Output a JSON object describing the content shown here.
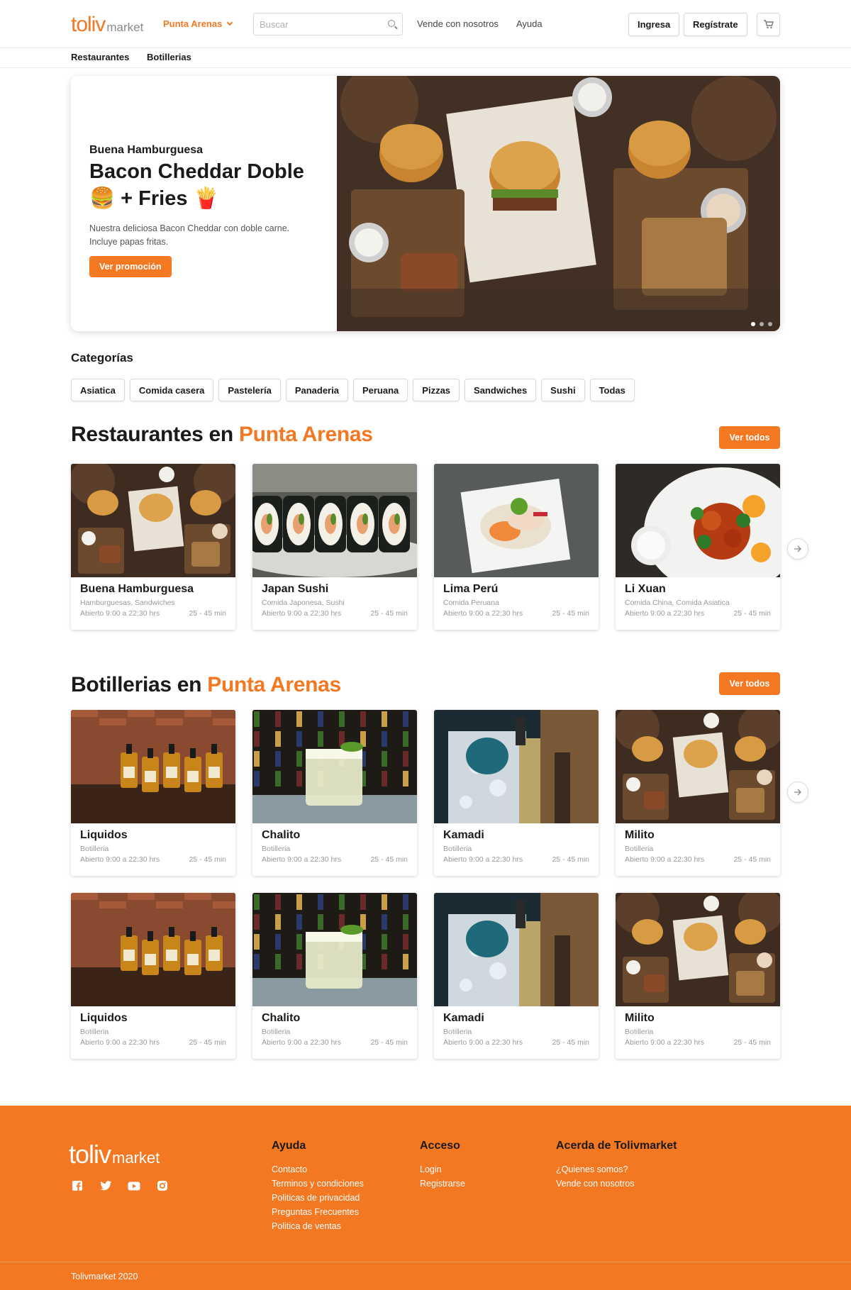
{
  "header": {
    "logo_main": "toliv",
    "logo_sub": "market",
    "city": "Punta Arenas",
    "search_placeholder": "Buscar",
    "links": [
      "Vende con nosotros",
      "Ayuda"
    ],
    "login": "Ingresa",
    "register": "Regístrate"
  },
  "subnav": [
    "Restaurantes",
    "Botillerias"
  ],
  "hero": {
    "restaurant": "Buena Hamburguesa",
    "title": "Bacon Cheddar Doble 🍔 + Fries 🍟",
    "description": "Nuestra deliciosa Bacon Cheddar con doble carne. Incluye papas fritas.",
    "cta": "Ver promoción",
    "slides": 3,
    "active_slide": 1
  },
  "categories": {
    "title": "Categorías",
    "items": [
      "Asiatica",
      "Comida casera",
      "Pastelería",
      "Panaderia",
      "Peruana",
      "Pizzas",
      "Sandwiches",
      "Sushi",
      "Todas"
    ]
  },
  "restaurants": {
    "title_prefix": "Restaurantes en ",
    "title_city": "Punta Arenas",
    "see_all": "Ver todos",
    "cards": [
      {
        "name": "Buena Hamburguesa",
        "sub": "Hamburguesas, Sandwiches",
        "hours": "Abierto 9:00 a 22:30 hrs",
        "time": "25 - 45 min",
        "image": "burgers"
      },
      {
        "name": "Japan Sushi",
        "sub": "Comida Japonesa, Sushi",
        "hours": "Abierto 9:00 a 22:30 hrs",
        "time": "25 - 45 min",
        "image": "sushi"
      },
      {
        "name": "Lima Perú",
        "sub": "Comida Peruana",
        "hours": "Abierto 9:00 a 22:30 hrs",
        "time": "25 - 45 min",
        "image": "ceviche"
      },
      {
        "name": "Li Xuan",
        "sub": "Comida China, Comida Asiatica",
        "hours": "Abierto 9:00 a 22:30 hrs",
        "time": "25 - 45 min",
        "image": "chicken"
      }
    ]
  },
  "botillerias": {
    "title_prefix": "Botillerias en ",
    "title_city": "Punta Arenas",
    "see_all": "Ver todos",
    "rows": [
      [
        {
          "name": "Liquidos",
          "sub": "Botilleria",
          "hours": "Abierto 9:00 a 22:30 hrs",
          "time": "25 - 45 min",
          "image": "whisky"
        },
        {
          "name": "Chalito",
          "sub": "Botilleria",
          "hours": "Abierto 9:00 a 22:30 hrs",
          "time": "25 - 45 min",
          "image": "pisco"
        },
        {
          "name": "Kamadi",
          "sub": "Botilleria",
          "hours": "Abierto 9:00 a 22:30 hrs",
          "time": "25 - 45 min",
          "image": "ice"
        },
        {
          "name": "Milito",
          "sub": "Botilleria",
          "hours": "Abierto 9:00 a 22:30 hrs",
          "time": "25 - 45 min",
          "image": "burgers"
        }
      ],
      [
        {
          "name": "Liquidos",
          "sub": "Botilleria",
          "hours": "Abierto 9:00 a 22:30 hrs",
          "time": "25 - 45 min",
          "image": "whisky"
        },
        {
          "name": "Chalito",
          "sub": "Botilleria",
          "hours": "Abierto 9:00 a 22:30 hrs",
          "time": "25 - 45 min",
          "image": "pisco"
        },
        {
          "name": "Kamadi",
          "sub": "Botilleria",
          "hours": "Abierto 9:00 a 22:30 hrs",
          "time": "25 - 45 min",
          "image": "ice"
        },
        {
          "name": "Milito",
          "sub": "Botilleria",
          "hours": "Abierto 9:00 a 22:30 hrs",
          "time": "25 - 45 min",
          "image": "burgers"
        }
      ]
    ]
  },
  "footer": {
    "logo_main": "toliv",
    "logo_sub": "market",
    "social": [
      "facebook-icon",
      "twitter-icon",
      "youtube-icon",
      "instagram-icon"
    ],
    "columns": [
      {
        "title": "Ayuda",
        "links": [
          "Contacto",
          "Terminos y condiciones",
          "Politicas de privacidad",
          "Preguntas Frecuentes",
          "Politica de ventas"
        ]
      },
      {
        "title": "Acceso",
        "links": [
          "Login",
          "Registrarse"
        ]
      },
      {
        "title": "Acerda de Tolivmarket",
        "links": [
          "¿Quienes somos?",
          "Vende con nosotros"
        ]
      }
    ],
    "copyright": "Tolivmarket 2020"
  },
  "colors": {
    "accent": "#f47721",
    "text": "#1a1a1a",
    "muted": "#9a9a9a"
  }
}
